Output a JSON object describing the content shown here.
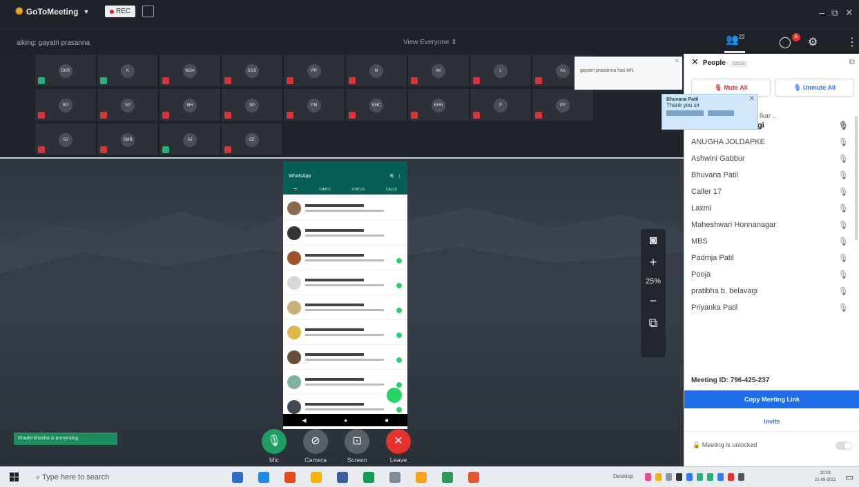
{
  "titlebar": {
    "app_name": "GoToMeeting",
    "rec_label": "REC"
  },
  "subbar": {
    "speaking": "alking: gayatri prasanna",
    "view_mode": "View Everyone",
    "people_count": "22",
    "chat_badge": "6"
  },
  "tiles": [
    {
      "initials": "DKR",
      "mic": "on"
    },
    {
      "initials": "K",
      "mic": "on"
    },
    {
      "initials": "NGH",
      "mic": "off"
    },
    {
      "initials": "SGS",
      "mic": "off"
    },
    {
      "initials": "PP",
      "mic": "off"
    },
    {
      "initials": "M",
      "mic": "off"
    },
    {
      "initials": "AK",
      "mic": "off"
    },
    {
      "initials": "L",
      "mic": "off"
    },
    {
      "initials": "AA",
      "mic": "off"
    },
    {
      "initials": "BP",
      "mic": "off"
    },
    {
      "initials": "SP",
      "mic": "off"
    },
    {
      "initials": "MH",
      "mic": "off"
    },
    {
      "initials": "SP",
      "mic": "off"
    },
    {
      "initials": "PM",
      "mic": "off"
    },
    {
      "initials": "SMC",
      "mic": "off"
    },
    {
      "initials": "KHN",
      "mic": "off"
    },
    {
      "initials": "P",
      "mic": "off"
    },
    {
      "initials": "PP",
      "mic": "off"
    },
    {
      "initials": "SJ",
      "mic": "off"
    },
    {
      "initials": "SMB",
      "mic": "off"
    },
    {
      "initials": "AJ",
      "mic": "on"
    },
    {
      "initials": "CE",
      "mic": "off"
    }
  ],
  "notification": "gayatri prasanna has left.",
  "message_popup": {
    "from": "Bhuvana Patil",
    "text": "Thank you sir"
  },
  "zoom": {
    "level": "25%"
  },
  "presenter_label": "Khaderbhasha is presenting",
  "controls": [
    {
      "label": "Mic",
      "color": "#1e9e63",
      "glyph": "🎙"
    },
    {
      "label": "Camera",
      "color": "#5a6069",
      "glyph": "⊘"
    },
    {
      "label": "Screen",
      "color": "#5a6069",
      "glyph": "⊡"
    },
    {
      "label": "Leave",
      "color": "#e5322d",
      "glyph": "✕"
    }
  ],
  "people": {
    "title": "People",
    "count": "22/250",
    "mute_all": "Mute All",
    "unmute_all": "Unmute All",
    "partial_name": "lkar ..",
    "list": [
      {
        "name": "Khaderbhasha (Orgi",
        "bold": true
      },
      {
        "name": "ANUGHA JOLDAPKE",
        "bold": false
      },
      {
        "name": "Ashwini Gabbur",
        "bold": false
      },
      {
        "name": "Bhuvana Patil",
        "bold": false
      },
      {
        "name": "Caller 17",
        "bold": false
      },
      {
        "name": "Laxmi",
        "bold": false
      },
      {
        "name": "Maheshwari Honnanagar",
        "bold": false
      },
      {
        "name": "MBS",
        "bold": false
      },
      {
        "name": "Padmja Patil",
        "bold": false
      },
      {
        "name": "Pooja",
        "bold": false
      },
      {
        "name": "pratibha b. belavagi",
        "bold": false
      },
      {
        "name": "Priyanka Patil",
        "bold": false
      }
    ],
    "meeting_id": "Meeting ID: 796-425-237",
    "copy_link": "Copy Meeting Link",
    "invite": "Invite",
    "lock": "Meeting is unlocked"
  },
  "taskbar": {
    "search_placeholder": "Type here to search",
    "desktop_label": "Desktop",
    "time": "20:18",
    "date": "21-09-2021"
  },
  "colors": {
    "accent_blue": "#1e6ee8",
    "leave_red": "#e5322d",
    "mic_green": "#1e9e63"
  }
}
